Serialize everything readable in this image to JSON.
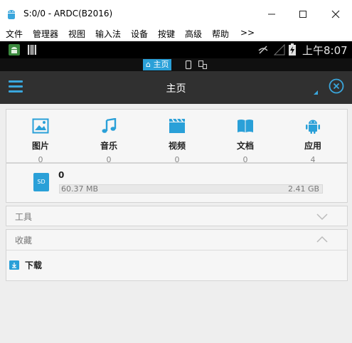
{
  "window": {
    "title": "S:0/0 - ARDC(B2016)",
    "controls": {
      "minimize": "—",
      "maximize": "☐",
      "close": "✕"
    }
  },
  "menu": [
    "文件",
    "管理器",
    "视图",
    "输入法",
    "设备",
    "按键",
    "高级",
    "帮助",
    ">>"
  ],
  "status_bar": {
    "time": "上午8:07"
  },
  "mode_switch": {
    "active": "主页"
  },
  "action_bar": {
    "title": "主页"
  },
  "categories": [
    {
      "label": "图片",
      "count": "0",
      "icon": "image-icon"
    },
    {
      "label": "音乐",
      "count": "0",
      "icon": "music-icon"
    },
    {
      "label": "视频",
      "count": "0",
      "icon": "video-icon"
    },
    {
      "label": "文档",
      "count": "0",
      "icon": "book-icon"
    },
    {
      "label": "应用",
      "count": "4",
      "icon": "android-icon"
    }
  ],
  "storage": {
    "name": "0",
    "icon_label": "SD",
    "used": "60.37 MB",
    "total": "2.41 GB"
  },
  "sections": {
    "tools": "工具",
    "favorites": "收藏"
  },
  "favorites": [
    {
      "label": "下载",
      "icon": "download-folder-icon"
    }
  ],
  "colors": {
    "accent": "#2aa0d8",
    "actionbar": "#303030",
    "statusbar": "#000000"
  }
}
